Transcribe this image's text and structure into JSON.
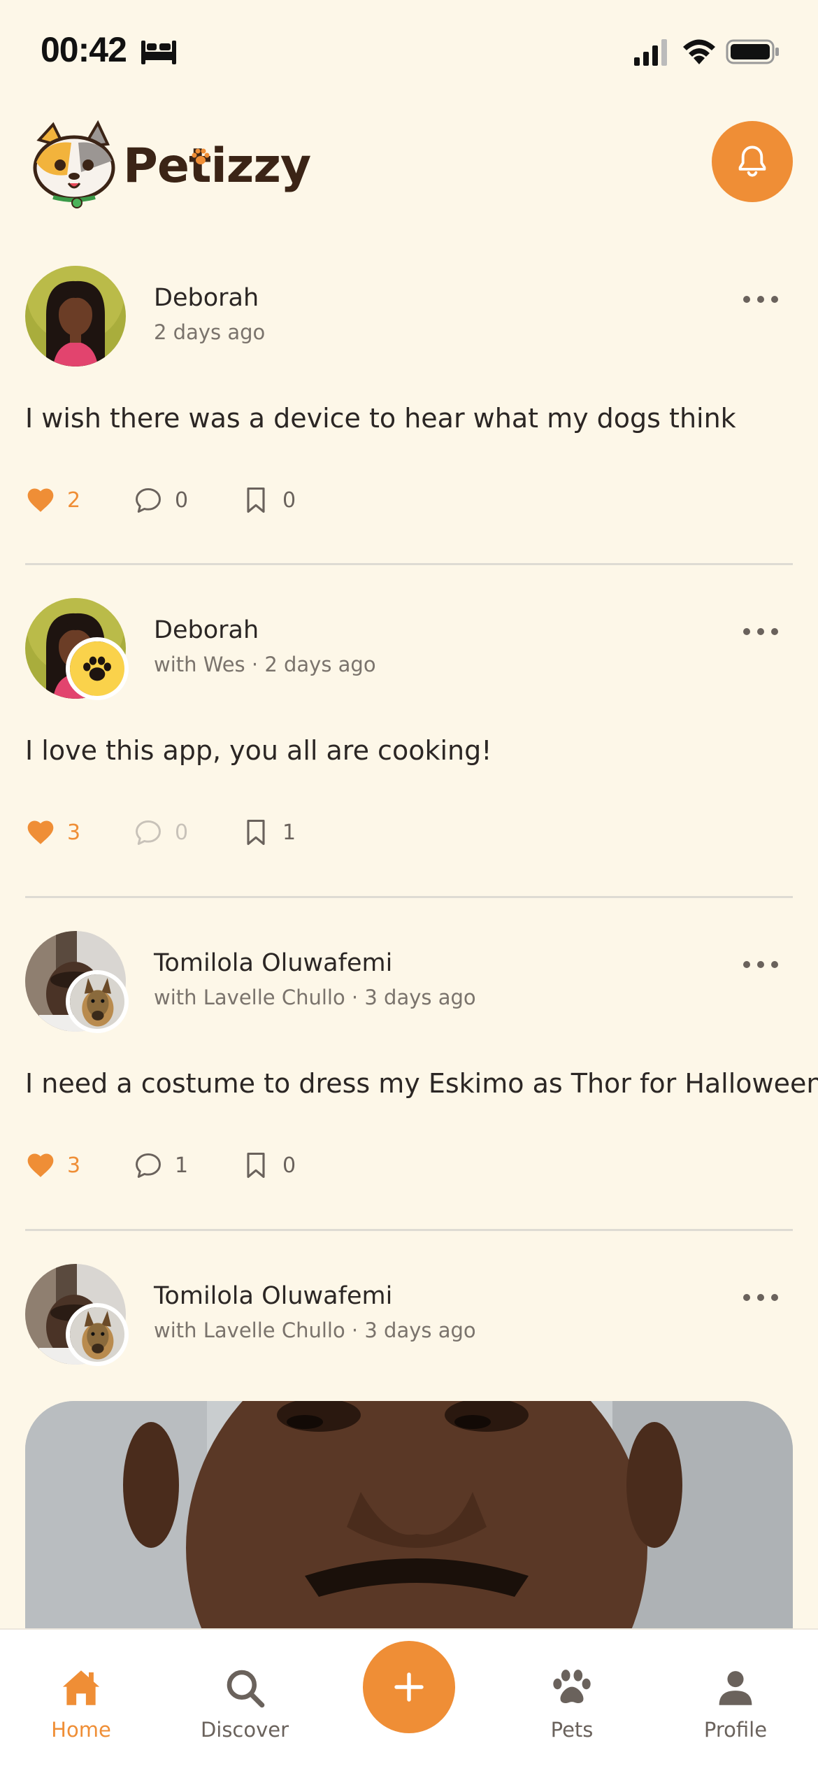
{
  "status_bar": {
    "time": "00:42",
    "icons": [
      "bed-icon",
      "signal-icon",
      "wifi-icon",
      "battery-icon"
    ]
  },
  "header": {
    "app_name": "Petizzy",
    "logo_icon": "cat-dog-mascot-logo",
    "notification_icon": "bell-icon"
  },
  "colors": {
    "background": "#FDF7E8",
    "accent": "#EF8E36",
    "text": "#2b2624",
    "muted_text": "#7a736c",
    "divider": "#DEDBD3",
    "nav_background": "#ffffff"
  },
  "posts": [
    {
      "author": "Deborah",
      "meta": "2 days ago",
      "text": "I wish there was a device to hear what my dogs think",
      "likes": "2",
      "comments": "0",
      "saves": "0"
    },
    {
      "author": "Deborah",
      "meta": "with Wes · 2 days ago",
      "text": "I love this app, you all are cooking!",
      "likes": "3",
      "comments": "0",
      "saves": "1"
    },
    {
      "author": "Tomilola Oluwafemi",
      "meta": "with Lavelle Chullo · 3 days ago",
      "text": "I need a costume to dress my Eskimo as Thor for Halloween",
      "likes": "3",
      "comments": "1",
      "saves": "0"
    },
    {
      "author": "Tomilola Oluwafemi",
      "meta": "with Lavelle Chullo · 3 days ago"
    }
  ],
  "bottom_nav": {
    "items": [
      {
        "label": "Home",
        "icon": "home-icon",
        "active": true
      },
      {
        "label": "Discover",
        "icon": "search-icon",
        "active": false
      },
      {
        "label": "",
        "icon": "plus-icon",
        "active": false
      },
      {
        "label": "Pets",
        "icon": "paw-icon",
        "active": false
      },
      {
        "label": "Profile",
        "icon": "person-icon",
        "active": false
      }
    ]
  }
}
